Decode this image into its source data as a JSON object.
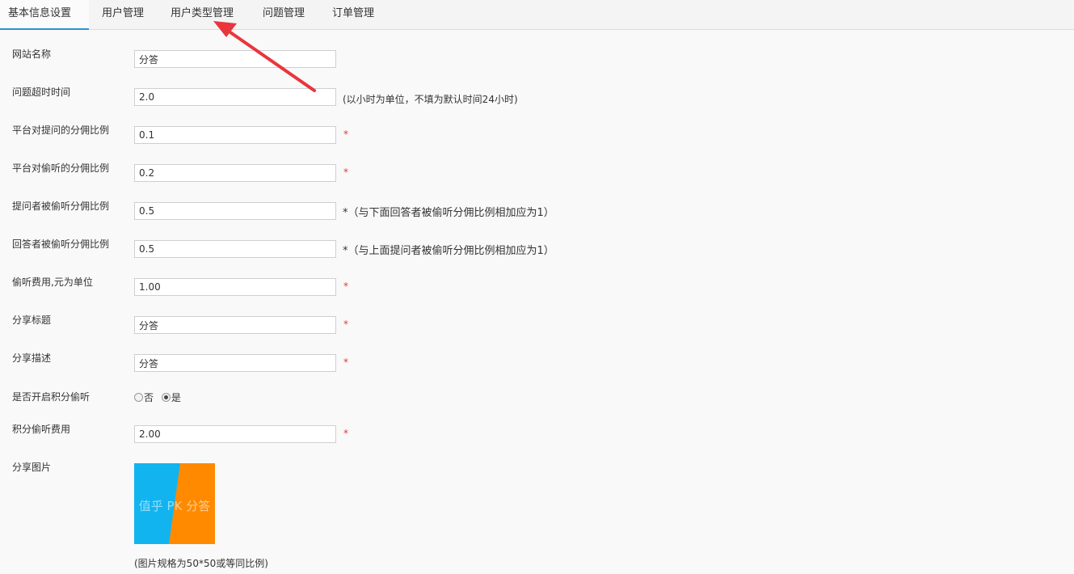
{
  "tabs": [
    {
      "label": "基本信息设置",
      "active": true
    },
    {
      "label": "用户管理"
    },
    {
      "label": "用户类型管理"
    },
    {
      "label": "问题管理"
    },
    {
      "label": "订单管理"
    }
  ],
  "form": {
    "site_name": {
      "label": "网站名称",
      "value": "分答"
    },
    "timeout": {
      "label": "问题超时时间",
      "value": "2.0",
      "hint": "(以小时为单位，不填为默认时间24小时)"
    },
    "platform_ask_ratio": {
      "label": "平台对提问的分佣比例",
      "value": "0.1",
      "required": "*"
    },
    "platform_listen_ratio": {
      "label": "平台对偷听的分佣比例",
      "value": "0.2",
      "required": "*"
    },
    "asker_ratio": {
      "label": "提问者被偷听分佣比例",
      "value": "0.5",
      "hint_star": "*",
      "hint": "（与下面回答者被偷听分佣比例相加应为1）"
    },
    "answerer_ratio": {
      "label": "回答者被偷听分佣比例",
      "value": "0.5",
      "hint_star": "*",
      "hint": "（与上面提问者被偷听分佣比例相加应为1）"
    },
    "listen_fee": {
      "label": "偷听费用,元为单位",
      "value": "1.00",
      "required": "*"
    },
    "share_title": {
      "label": "分享标题",
      "value": "分答",
      "required": "*"
    },
    "share_desc": {
      "label": "分享描述",
      "value": "分答",
      "required": "*"
    },
    "points_listen": {
      "label": "是否开启积分偷听",
      "options": [
        "否",
        "是"
      ],
      "selected": "是"
    },
    "points_fee": {
      "label": "积分偷听费用",
      "value": "2.00",
      "required": "*"
    },
    "share_image": {
      "label": "分享图片",
      "image_text": "值乎 PK 分答",
      "caption": "(图片规格为50*50或等同比例)",
      "colors": {
        "left": "#12b4f0",
        "right": "#ff8a00"
      }
    }
  },
  "colors": {
    "accent": "#2a93d5",
    "arrow": "#e8363c",
    "required": "#e33"
  }
}
